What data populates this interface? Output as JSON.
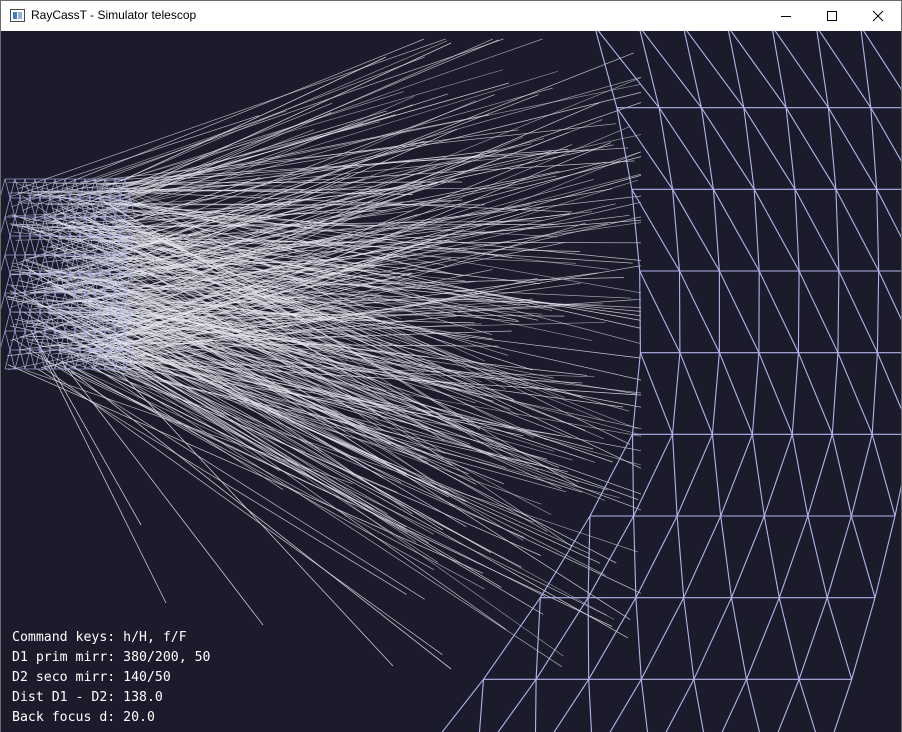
{
  "window": {
    "title": "RayCassT - Simulator telescop"
  },
  "titlebar_buttons": {
    "minimize": "minimize-icon",
    "maximize": "maximize-icon",
    "close": "close-icon"
  },
  "colors": {
    "background": "#1c1b2b",
    "rays": "#e6e6ee",
    "mesh": "#b4b4ee",
    "text": "#ffffff"
  },
  "info": {
    "line1": "Command keys: h/H, f/F",
    "line2": "D1 prim mirr: 380/200, 50",
    "line3": "D2 seco mirr: 140/50",
    "line4": "Dist D1 - D2: 138.0",
    "line5": "Back focus d: 20.0"
  }
}
